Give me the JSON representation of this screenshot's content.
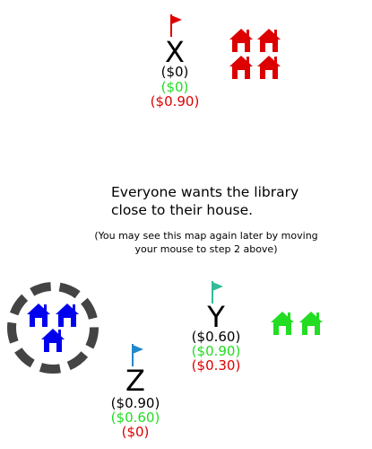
{
  "message": {
    "main": "Everyone wants the library close to their house.",
    "note": "(You may see this map again later by moving your mouse to step 2 above)"
  },
  "colors": {
    "red": "#dd0000",
    "green": "#22dd22",
    "blue": "#0000ee",
    "teal_flag": "#33bb99",
    "dark_flag": "#2288cc",
    "ring": "#444444"
  },
  "locations": {
    "X": {
      "label": "X",
      "flag_icon": "red-flag-icon",
      "costs": {
        "black": "($0)",
        "green": "($0)",
        "red": "($0.90)"
      }
    },
    "Y": {
      "label": "Y",
      "flag_icon": "teal-flag-icon",
      "costs": {
        "black": "($0.60)",
        "green": "($0.90)",
        "red": "($0.30)"
      }
    },
    "Z": {
      "label": "Z",
      "flag_icon": "blue-flag-icon",
      "costs": {
        "black": "($0.90)",
        "green": "($0.60)",
        "red": "($0)"
      }
    }
  },
  "house_groups": {
    "red": {
      "icon": "house-icon",
      "count": 4
    },
    "green": {
      "icon": "house-icon",
      "count": 2
    },
    "blue": {
      "icon": "house-icon",
      "count": 3
    }
  },
  "library_marker": {
    "icon": "dashed-ring-icon"
  }
}
